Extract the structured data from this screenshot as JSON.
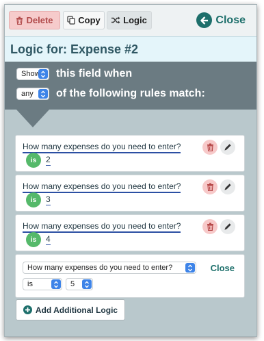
{
  "toolbar": {
    "delete_label": "Delete",
    "copy_label": "Copy",
    "logic_label": "Logic",
    "close_label": "Close"
  },
  "title": "Logic for: Expense #2",
  "header": {
    "action_select": "Show",
    "line1_text": "this field when",
    "match_select": "any",
    "line2_text": "of the following rules match:"
  },
  "rules": [
    {
      "question": "How many expenses do you need to enter?",
      "operator": "is",
      "value": "2"
    },
    {
      "question": "How many expenses do you need to enter?",
      "operator": "is",
      "value": "3"
    },
    {
      "question": "How many expenses do you need to enter?",
      "operator": "is",
      "value": "4"
    }
  ],
  "edit_rule": {
    "question_select": "How many expenses do you need to enter?",
    "operator_select": "is",
    "value_select": "5",
    "close_label": "Close"
  },
  "add_label": "Add Additional Logic",
  "colors": {
    "accent": "#1d6f6b",
    "header_bg": "#6b7b82",
    "panel_bg": "#b9c8cc",
    "badge_green": "#55b96a",
    "select_blue": "#3e84e8"
  }
}
